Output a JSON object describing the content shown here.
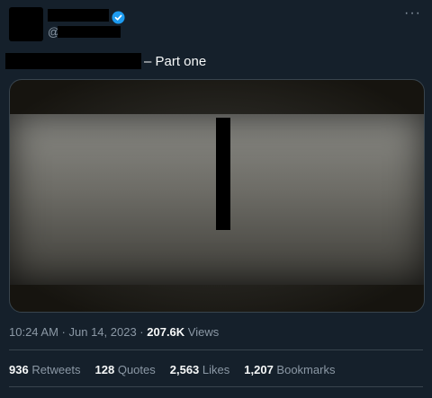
{
  "tweet": {
    "handle_prefix": "@",
    "text_visible": "– Part one",
    "menu_glyph": "···"
  },
  "media": {
    "caption": ""
  },
  "meta": {
    "time": "10:24 AM",
    "sep1": " · ",
    "date": "Jun 14, 2023",
    "sep2": " · ",
    "views_count": "207.6K",
    "views_label": " Views"
  },
  "stats": {
    "retweets_count": "936",
    "retweets_label": " Retweets",
    "quotes_count": "128",
    "quotes_label": " Quotes",
    "likes_count": "2,563",
    "likes_label": " Likes",
    "bookmarks_count": "1,207",
    "bookmarks_label": " Bookmarks"
  },
  "colors": {
    "background": "#15202b",
    "verified": "#1d9bf0",
    "muted": "#8b98a5"
  }
}
